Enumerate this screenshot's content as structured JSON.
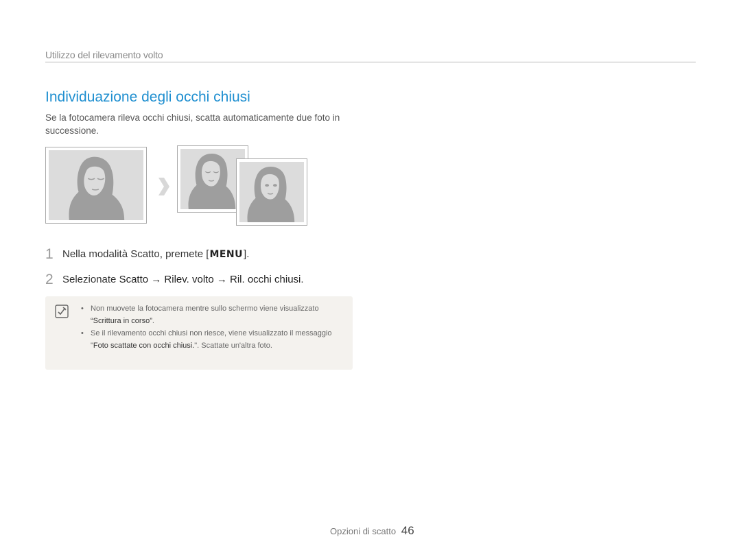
{
  "header": {
    "section": "Utilizzo del rilevamento volto"
  },
  "title": "Individuazione degli occhi chiusi",
  "intro": "Se la fotocamera rileva occhi chiusi, scatta automaticamente due foto in successione.",
  "steps": [
    {
      "num": "1",
      "text_before": "Nella modalità Scatto, premete [",
      "key": "MENU",
      "text_after": "]."
    },
    {
      "num": "2",
      "text_before": "Selezionate ",
      "path": "Scatto → Rilev. volto → Ril. occhi chiusi",
      "text_after": "."
    }
  ],
  "note": {
    "icon": "note-pencil-icon",
    "bullets": [
      {
        "dot": "•",
        "a": "Non muovete la fotocamera mentre sullo schermo viene visualizzato ",
        "b": "“Scrittura in corso”",
        "c": "."
      },
      {
        "dot": "•",
        "a": "Se il rilevamento occhi chiusi non riesce, viene visualizzato il messaggio \"",
        "b": "Foto scattate con occhi chiusi.",
        "c": "\". Scattate un'altra foto."
      }
    ]
  },
  "footer": {
    "label": "Opzioni di scatto",
    "page": "46"
  },
  "colors": {
    "title": "#1f8fd0",
    "photo_bg": "#dcdcdc",
    "silhouette": "#9e9e9e",
    "note_bg": "#f4f2ee"
  }
}
